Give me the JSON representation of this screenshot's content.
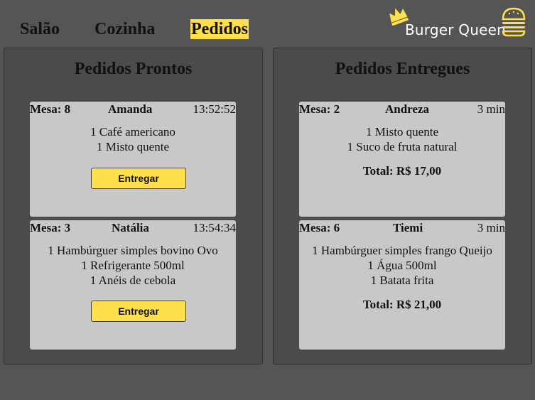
{
  "nav": {
    "salao": "Salão",
    "cozinha": "Cozinha",
    "pedidos": "Pedidos"
  },
  "brand": {
    "name": "Burger Queen",
    "accent": "#ffdf4b"
  },
  "ready": {
    "title": "Pedidos Prontos",
    "orders": [
      {
        "mesa": "Mesa: 8",
        "client": "Amanda",
        "time": "13:52:52",
        "items": [
          "1 Café americano",
          "1 Misto quente"
        ],
        "button": "Entregar"
      },
      {
        "mesa": "Mesa: 3",
        "client": "Natália",
        "time": "13:54:34",
        "items": [
          "1 Hambúrguer simples bovino Ovo",
          "1 Refrigerante 500ml",
          "1 Anéis de cebola"
        ],
        "button": "Entregar"
      }
    ]
  },
  "delivered": {
    "title": "Pedidos Entregues",
    "orders": [
      {
        "mesa": "Mesa: 2",
        "client": "Andreza",
        "time": "3 min",
        "items": [
          "1 Misto quente",
          "1 Suco de fruta natural"
        ],
        "total": "Total: R$ 17,00"
      },
      {
        "mesa": "Mesa: 6",
        "client": "Tiemi",
        "time": "3 min",
        "items": [
          "1 Hambúrguer simples frango Queijo",
          "1 Água 500ml",
          "1 Batata frita"
        ],
        "total": "Total: R$ 21,00"
      }
    ]
  }
}
